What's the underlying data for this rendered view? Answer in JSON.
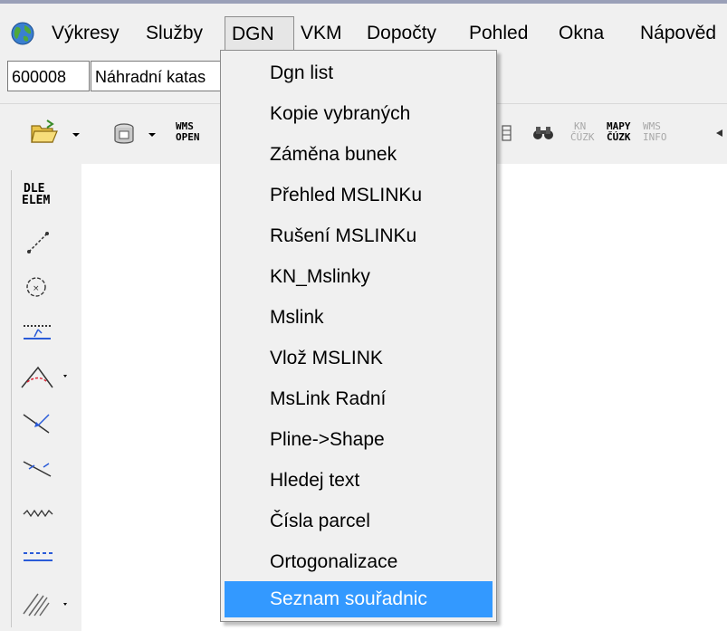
{
  "menubar": {
    "items": [
      "Výkresy",
      "Služby",
      "DGN",
      "VKM",
      "Dopočty",
      "Pohled",
      "Okna",
      "Nápověd"
    ],
    "active": "DGN"
  },
  "fields": {
    "code": "600008",
    "name": "Náhradní katas"
  },
  "toolbar": {
    "wms_open": [
      "WMS",
      "OPEN"
    ],
    "kn_cuzk": [
      "KN",
      "ČÚZK"
    ],
    "mapy_cuzk": [
      "MAPY",
      "ČÚZK"
    ],
    "wms_info": [
      "WMS",
      "INFO"
    ]
  },
  "sidebar": {
    "dle_elem": [
      "DLE",
      "ELEM"
    ]
  },
  "dropdown": {
    "items": [
      "Dgn list",
      "Kopie vybraných",
      "Záměna bunek",
      "Přehled MSLINKu",
      "Rušení MSLINKu",
      "KN_Mslinky",
      "Mslink",
      "Vlož MSLINK",
      "MsLink Radní",
      "Pline->Shape",
      "Hledej text",
      "Čísla parcel",
      "Ortogonalizace",
      "Seznam souřadnic"
    ],
    "selected_index": 13
  },
  "colors": {
    "selection": "#3399ff",
    "chrome": "#f0f0f0"
  }
}
